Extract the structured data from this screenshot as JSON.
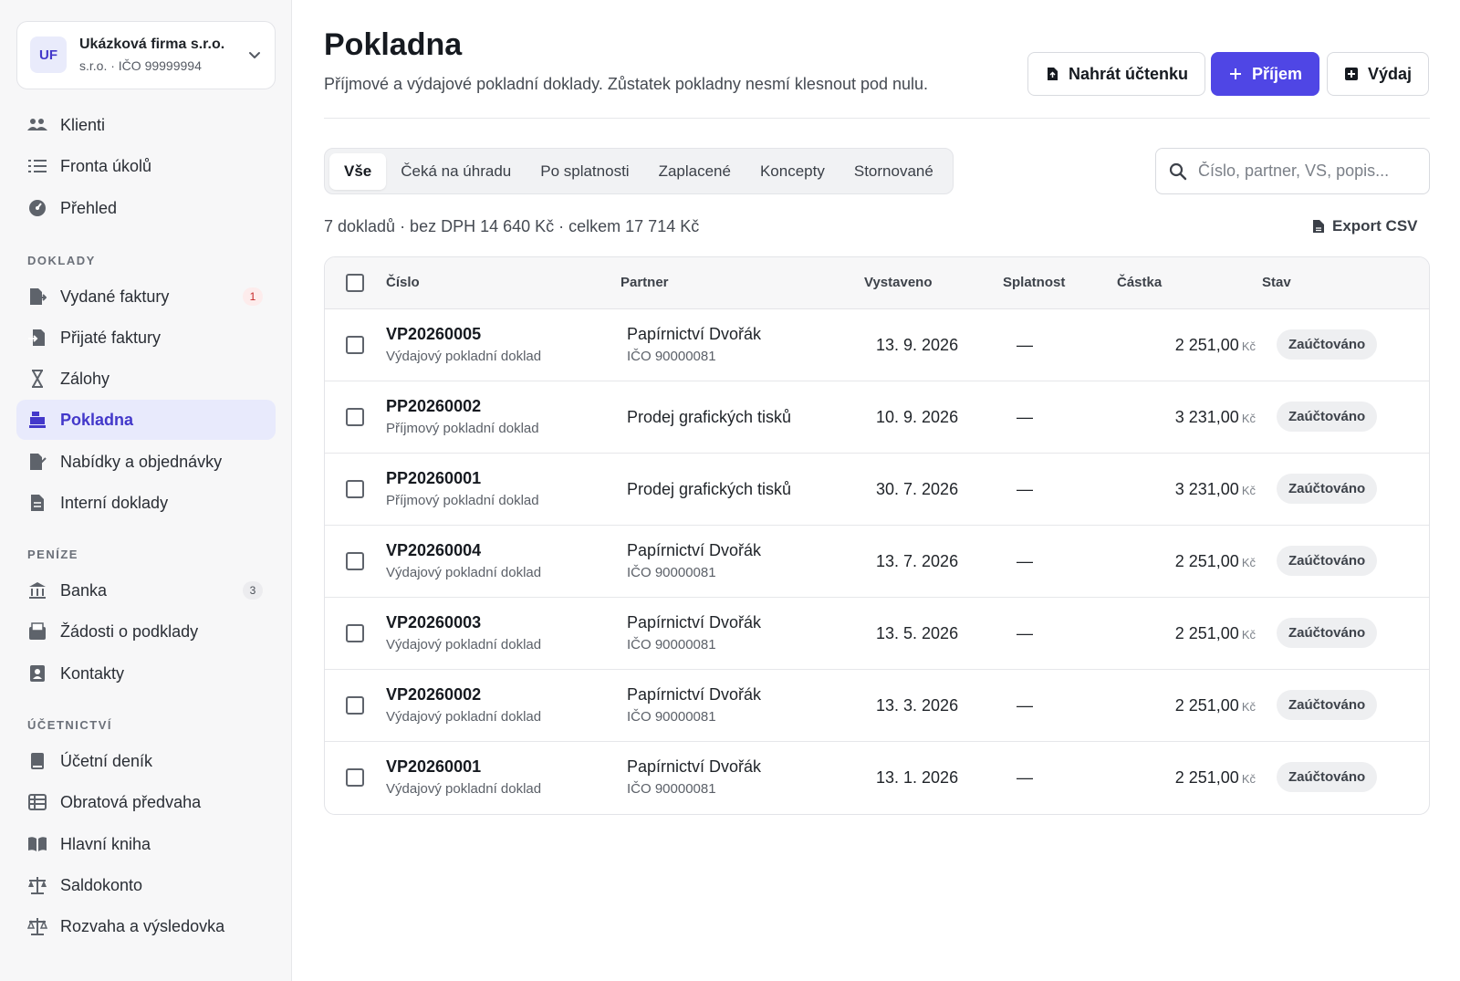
{
  "company": {
    "initials": "UF",
    "name": "Ukázková firma s.r.o.",
    "subtitle": "s.r.o. · IČO 99999994"
  },
  "sidebar": {
    "top_items": [
      {
        "label": "Klienti",
        "icon": "users-icon"
      },
      {
        "label": "Fronta úkolů",
        "icon": "task-list-icon"
      },
      {
        "label": "Přehled",
        "icon": "dashboard-gauge-icon"
      }
    ],
    "sections": [
      {
        "title": "DOKLADY",
        "items": [
          {
            "label": "Vydané faktury",
            "icon": "invoice-out-icon",
            "count": "1"
          },
          {
            "label": "Přijaté faktury",
            "icon": "invoice-in-icon"
          },
          {
            "label": "Zálohy",
            "icon": "hourglass-icon"
          },
          {
            "label": "Pokladna",
            "icon": "cash-register-icon",
            "active": true
          },
          {
            "label": "Nabídky a objednávky",
            "icon": "file-signature-icon"
          },
          {
            "label": "Interní doklady",
            "icon": "file-icon"
          }
        ]
      },
      {
        "title": "PENÍZE",
        "items": [
          {
            "label": "Banka",
            "icon": "bank-icon",
            "count": "3"
          },
          {
            "label": "Žádosti o podklady",
            "icon": "inbox-request-icon"
          },
          {
            "label": "Kontakty",
            "icon": "contact-card-icon"
          }
        ]
      },
      {
        "title": "ÚČETNICTVÍ",
        "items": [
          {
            "label": "Účetní deník",
            "icon": "journal-book-icon"
          },
          {
            "label": "Obratová předvaha",
            "icon": "table-list-icon"
          },
          {
            "label": "Hlavní kniha",
            "icon": "open-book-icon"
          },
          {
            "label": "Saldokonto",
            "icon": "scale-icon"
          },
          {
            "label": "Rozvaha a výsledovka",
            "icon": "balance-scale-icon"
          }
        ]
      }
    ]
  },
  "header": {
    "title": "Pokladna",
    "description": "Příjmové a výdajové pokladní doklady. Zůstatek pokladny nesmí klesnout pod nulu.",
    "buttons": {
      "upload": "Nahrát účtenku",
      "income": "Příjem",
      "expense": "Výdaj"
    }
  },
  "tabs": [
    "Vše",
    "Čeká na úhradu",
    "Po splatnosti",
    "Zaplacené",
    "Koncepty",
    "Stornované"
  ],
  "active_tab": "Vše",
  "search": {
    "placeholder": "Číslo, partner, VS, popis..."
  },
  "summary": "7 dokladů · bez DPH 14 640 Kč · celkem 17 714 Kč",
  "export_label": "Export CSV",
  "table": {
    "columns": [
      "Číslo",
      "Partner",
      "Vystaveno",
      "Splatnost",
      "Částka",
      "Stav"
    ],
    "currency": "Kč",
    "rows": [
      {
        "number": "VP20260005",
        "type": "Výdajový pokladní doklad",
        "partner": "Papírnictví Dvořák",
        "ico": "IČO 90000081",
        "issued": "13. 9. 2026",
        "due": "—",
        "amount": "2 251,00",
        "status": "Zaúčtováno"
      },
      {
        "number": "PP20260002",
        "type": "Příjmový pokladní doklad",
        "partner": "Prodej grafických tisků",
        "ico": "",
        "issued": "10. 9. 2026",
        "due": "—",
        "amount": "3 231,00",
        "status": "Zaúčtováno"
      },
      {
        "number": "PP20260001",
        "type": "Příjmový pokladní doklad",
        "partner": "Prodej grafických tisků",
        "ico": "",
        "issued": "30. 7. 2026",
        "due": "—",
        "amount": "3 231,00",
        "status": "Zaúčtováno"
      },
      {
        "number": "VP20260004",
        "type": "Výdajový pokladní doklad",
        "partner": "Papírnictví Dvořák",
        "ico": "IČO 90000081",
        "issued": "13. 7. 2026",
        "due": "—",
        "amount": "2 251,00",
        "status": "Zaúčtováno"
      },
      {
        "number": "VP20260003",
        "type": "Výdajový pokladní doklad",
        "partner": "Papírnictví Dvořák",
        "ico": "IČO 90000081",
        "issued": "13. 5. 2026",
        "due": "—",
        "amount": "2 251,00",
        "status": "Zaúčtováno"
      },
      {
        "number": "VP20260002",
        "type": "Výdajový pokladní doklad",
        "partner": "Papírnictví Dvořák",
        "ico": "IČO 90000081",
        "issued": "13. 3. 2026",
        "due": "—",
        "amount": "2 251,00",
        "status": "Zaúčtováno"
      },
      {
        "number": "VP20260001",
        "type": "Výdajový pokladní doklad",
        "partner": "Papírnictví Dvořák",
        "ico": "IČO 90000081",
        "issued": "13. 1. 2026",
        "due": "—",
        "amount": "2 251,00",
        "status": "Zaúčtováno"
      }
    ]
  },
  "colors": {
    "accent": "#4f46e5",
    "accent_bg": "#e8eafc",
    "badge_red": "#c62828"
  }
}
